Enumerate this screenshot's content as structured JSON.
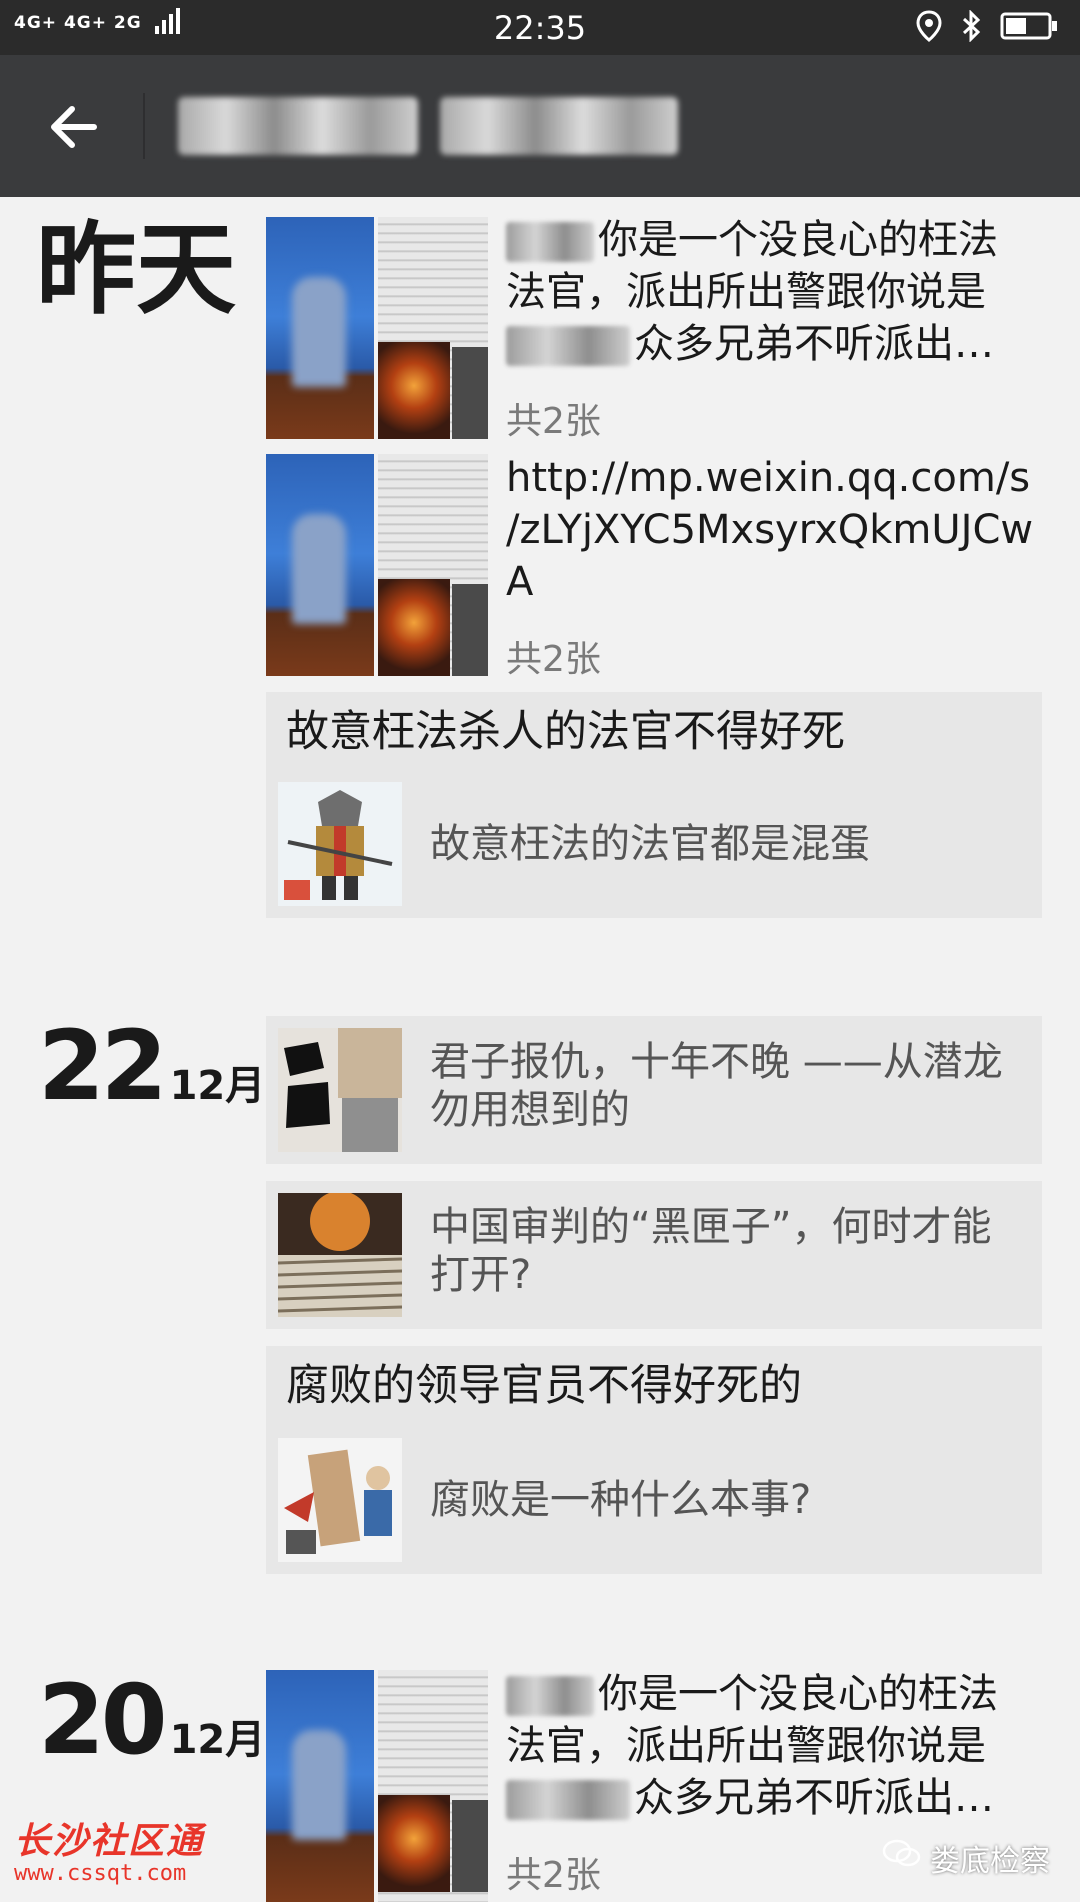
{
  "status_bar": {
    "network": "4G+ 4G+ 2G",
    "time": "22:35"
  },
  "groups": [
    {
      "date": "昨天",
      "posts": [
        {
          "text": "你是一个没良心的枉法法官，派出所出警跟你说是众多兄弟不听派出…",
          "line1": "你是一个没良心的枉法",
          "line2": "法官，派出所出警跟你说是",
          "line3": "众多兄弟不听派出…",
          "count": "共2张"
        },
        {
          "line1": "http://mp.weixin.qq.com/s",
          "line2": "/zLYjXYC5MxsyrxQkmUJCw",
          "line3": "A",
          "count": "共2张"
        }
      ],
      "cards": [
        {
          "title": "故意枉法杀人的法官不得好死",
          "text": "故意枉法的法官都是混蛋"
        }
      ]
    },
    {
      "day": "22",
      "month": "12月",
      "cards": [
        {
          "line1": "君子报仇，十年不晚 ——从潜龙",
          "line2": "勿用想到的"
        },
        {
          "line1": "中国审判的“黑匣子”，何时才能",
          "line2": "打开?"
        },
        {
          "title": "腐败的领导官员不得好死的",
          "text": "腐败是一种什么本事?"
        }
      ]
    },
    {
      "day": "20",
      "month": "12月",
      "posts": [
        {
          "line1": "你是一个没良心的枉法",
          "line2": "法官，派出所出警跟你说是",
          "line3": "众多兄弟不听派出…",
          "count": "共2张"
        }
      ]
    }
  ],
  "watermarks": {
    "left_main": "长沙社区通",
    "left_sub": "www.cssqt.com",
    "right": "娄底检察"
  }
}
